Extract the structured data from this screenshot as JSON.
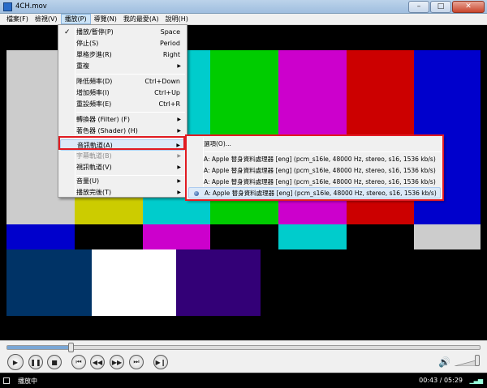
{
  "window": {
    "title": "4CH.mov",
    "min": "–",
    "max": "□",
    "close": "✕"
  },
  "menubar": [
    {
      "label": "檔案(F)"
    },
    {
      "label": "檢視(V)"
    },
    {
      "label": "播放(P)"
    },
    {
      "label": "導覽(N)"
    },
    {
      "label": "我的最愛(A)"
    },
    {
      "label": "說明(H)"
    }
  ],
  "play_menu": {
    "items": [
      {
        "label": "播放/暫停(P)",
        "shortcut": "Space"
      },
      {
        "label": "停止(S)",
        "shortcut": "Period"
      },
      {
        "label": "單格步進(R)",
        "shortcut": "Right"
      },
      {
        "label": "重複"
      },
      {
        "label": "降低頻率(D)",
        "shortcut": "Ctrl+Down"
      },
      {
        "label": "增加頻率(I)",
        "shortcut": "Ctrl+Up"
      },
      {
        "label": "重設頻率(E)",
        "shortcut": "Ctrl+R"
      },
      {
        "label": "轉換器 (Filter) (F)"
      },
      {
        "label": "著色器 (Shader) (H)"
      },
      {
        "label": "音訊軌道(A)"
      },
      {
        "label": "字幕軌道(B)"
      },
      {
        "label": "視訊軌道(V)"
      },
      {
        "label": "音量(U)"
      },
      {
        "label": "播放完後(T)"
      }
    ]
  },
  "audio_submenu": {
    "options_label": "選項(O)...",
    "tracks": [
      "A: Apple 替身資料處理器 [eng] (pcm_s16le, 48000 Hz, stereo, s16, 1536 kb/s)",
      "A: Apple 替身資料處理器 [eng] (pcm_s16le, 48000 Hz, stereo, s16, 1536 kb/s)",
      "A: Apple 替身資料處理器 [eng] (pcm_s16le, 48000 Hz, stereo, s16, 1536 kb/s)",
      "A: Apple 替身資料處理器 [eng] (pcm_s16le, 48000 Hz, stereo, s16, 1536 kb/s)"
    ]
  },
  "playback": {
    "progress_fraction": 0.135,
    "volume_fraction": 0.95
  },
  "status": {
    "text": "播放中",
    "time": "00:43 / 05:29"
  },
  "colors": {
    "gray": "#cccccc",
    "yellow": "#cccc00",
    "cyan": "#00cccc",
    "green": "#00cc00",
    "magenta": "#cc00cc",
    "red": "#cc0000",
    "blue": "#0000cc",
    "black": "#000000",
    "navy": "#003366",
    "white": "#ffffff",
    "purple": "#330077",
    "highlight_red": "#e11b22"
  },
  "icons": [
    "app-icon",
    "check-icon",
    "submenu-arrow-icon",
    "radio-selected-icon",
    "play-icon",
    "pause-icon",
    "stop-icon",
    "skip-back-icon",
    "rewind-icon",
    "fast-forward-icon",
    "skip-forward-icon",
    "frame-step-icon",
    "volume-icon",
    "status-icon"
  ]
}
